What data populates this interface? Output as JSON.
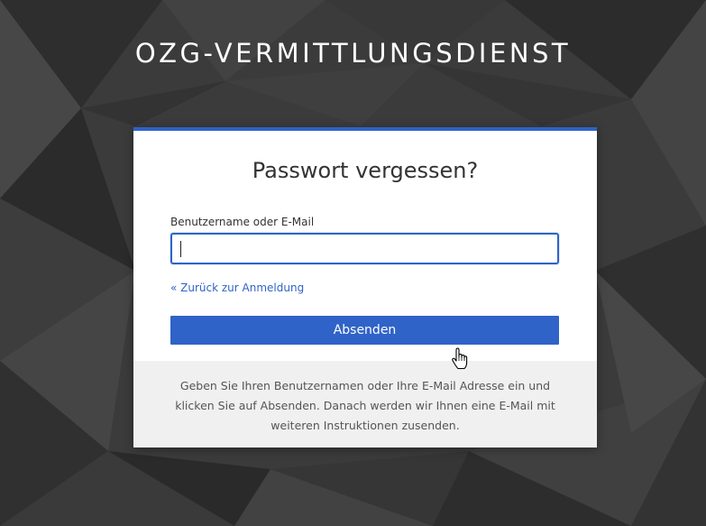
{
  "header": {
    "brand_title": "OZG-VERMITTLUNGSDIENST"
  },
  "form": {
    "title": "Passwort vergessen?",
    "username_label": "Benutzername oder E-Mail",
    "username_value": "",
    "back_link": "« Zurück zur Anmeldung",
    "submit_label": "Absenden"
  },
  "info": {
    "text": "Geben Sie Ihren Benutzernamen oder Ihre E-Mail Adresse ein und klicken Sie auf Absenden. Danach werden wir Ihnen eine E-Mail mit weiteren Instruktionen zusenden."
  },
  "colors": {
    "accent": "#2f63c8",
    "background": "#3a3a3a",
    "info_bg": "#f0f0f0"
  },
  "icons": {
    "cursor": "hand-pointer-icon"
  }
}
